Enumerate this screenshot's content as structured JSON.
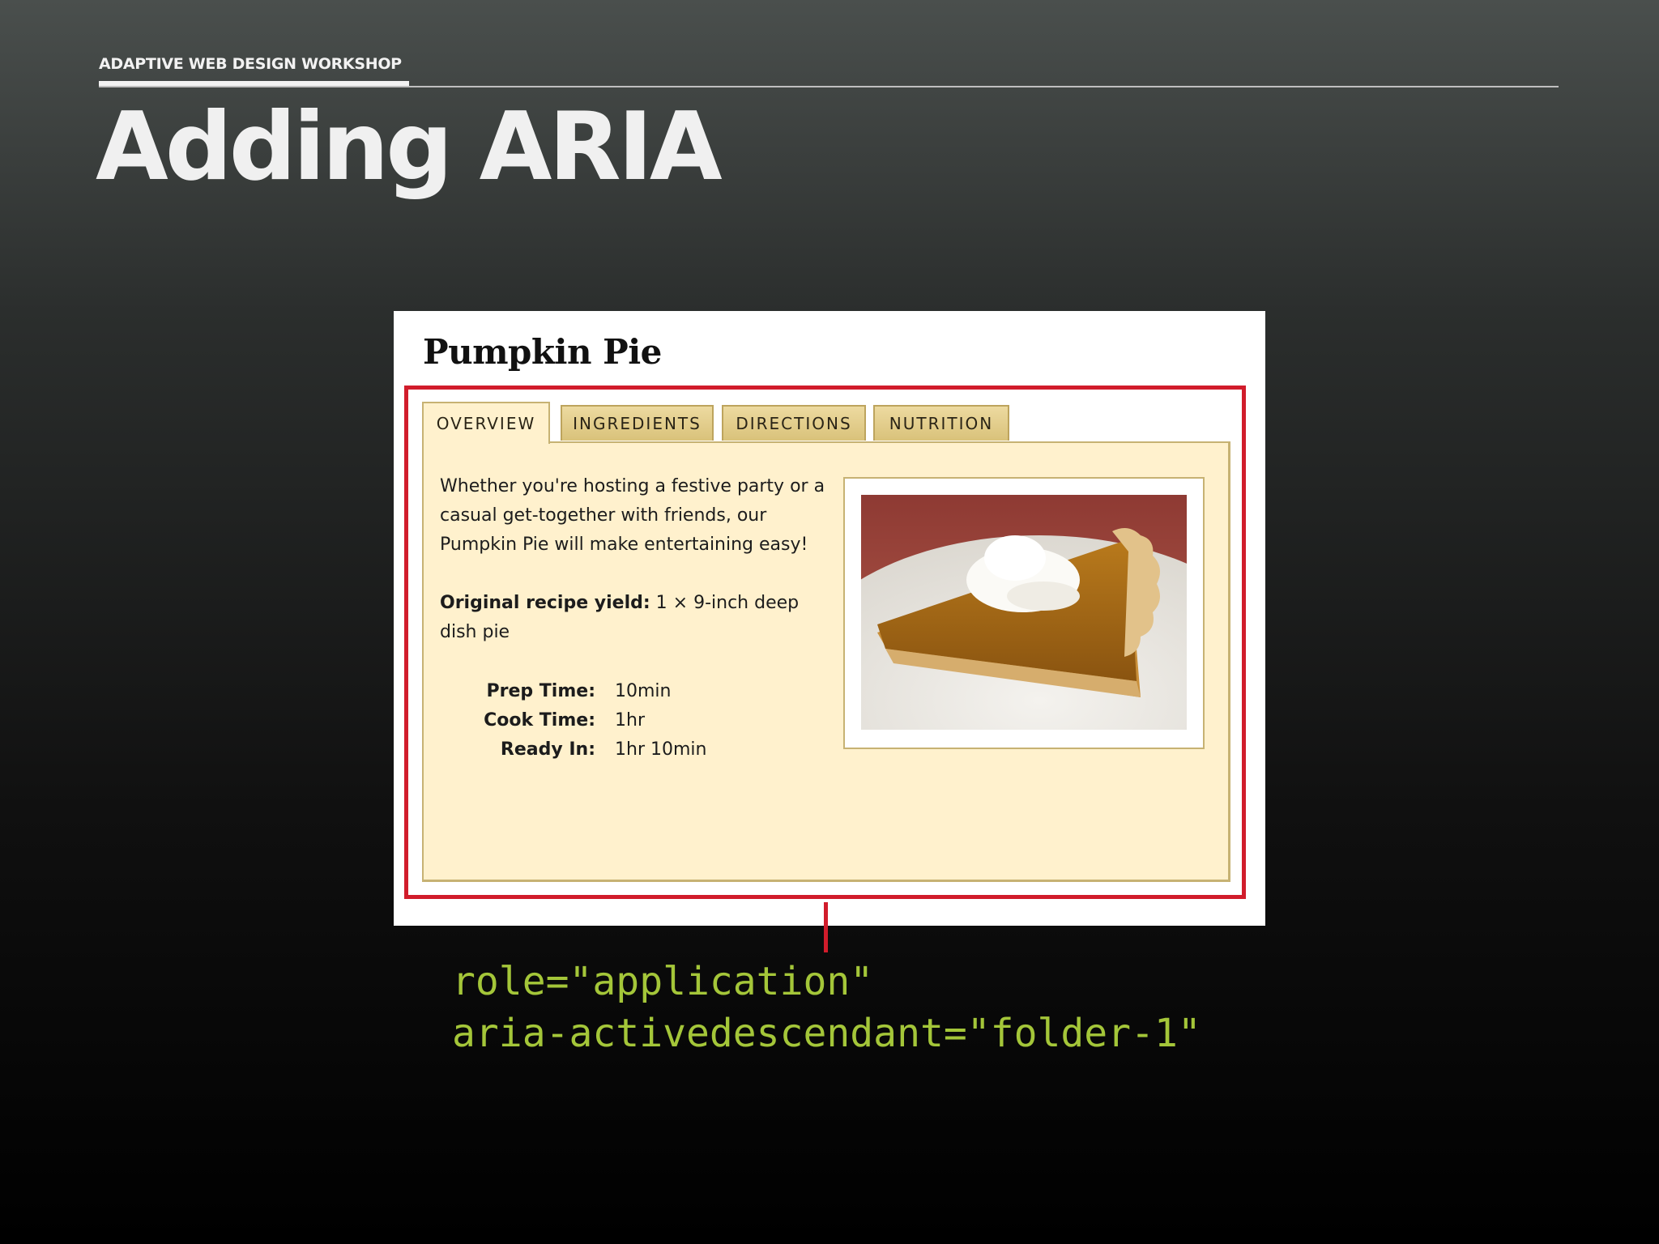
{
  "slide": {
    "kicker": "ADAPTIVE WEB DESIGN WORKSHOP",
    "title": "Adding ARIA"
  },
  "recipe": {
    "title": "Pumpkin Pie",
    "tabs": [
      {
        "label": "OVERVIEW",
        "active": true
      },
      {
        "label": "INGREDIENTS",
        "active": false
      },
      {
        "label": "DIRECTIONS",
        "active": false
      },
      {
        "label": "NUTRITION",
        "active": false
      }
    ],
    "description": "Whether you're hosting a festive party or a casual get-together with friends, our Pumpkin Pie will make entertaining easy!",
    "yield_label": "Original recipe yield:",
    "yield_value": "1 × 9-inch deep dish pie",
    "times": [
      {
        "label": "Prep Time:",
        "value": "10min"
      },
      {
        "label": "Cook Time:",
        "value": "1hr"
      },
      {
        "label": "Ready In:",
        "value": "1hr 10min"
      }
    ],
    "photo_subject": "pumpkin-pie-slice-photo"
  },
  "annotation": {
    "line1": "role=\"application\"",
    "line2": "aria-activedescendant=\"folder-1\""
  },
  "colors": {
    "highlight": "#d11c2b",
    "code": "#a4c639",
    "panel": "#fff1cd",
    "tab": "#dcc57e"
  }
}
